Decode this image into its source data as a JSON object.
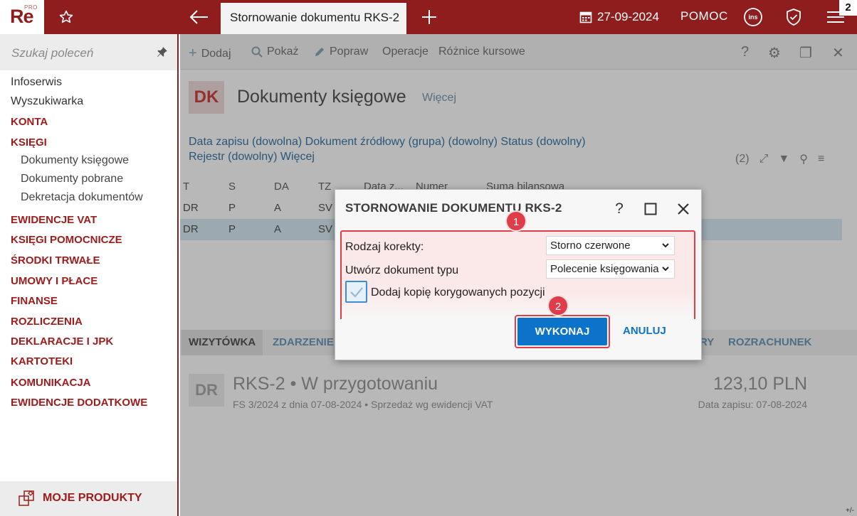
{
  "topbar": {
    "logo_main": "Re",
    "logo_sup": "PRO",
    "tab_title": "Stornowanie dokumentu RKS-2",
    "date": "27-09-2024",
    "help": "POMOC",
    "ins_label": "ins",
    "notification_count": "2"
  },
  "sidebar": {
    "search_placeholder": "Szukaj poleceń",
    "items": [
      {
        "label": "Infoserwis"
      },
      {
        "label": "Wyszukiwarka"
      },
      {
        "label": "KONTA"
      },
      {
        "label": "KSIĘGI"
      },
      {
        "label": "Dokumenty księgowe"
      },
      {
        "label": "Dokumenty pobrane"
      },
      {
        "label": "Dekretacja dokumentów"
      },
      {
        "label": "EWIDENCJE VAT"
      },
      {
        "label": "KSIĘGI POMOCNICZE"
      },
      {
        "label": "ŚRODKI TRWAŁE"
      },
      {
        "label": "UMOWY I PŁACE"
      },
      {
        "label": "FINANSE"
      },
      {
        "label": "ROZLICZENIA"
      },
      {
        "label": "DEKLARACJE I JPK"
      },
      {
        "label": "KARTOTEKI"
      },
      {
        "label": "KOMUNIKACJA"
      },
      {
        "label": "EWIDENCJE DODATKOWE"
      }
    ],
    "footer_label": "MOJE PRODUKTY"
  },
  "main": {
    "toolbar": {
      "add": "Dodaj",
      "show": "Pokaż",
      "edit": "Popraw",
      "operations": "Operacje",
      "fx": "Różnice kursowe",
      "help": "?"
    },
    "page": {
      "badge": "DK",
      "title": "Dokumenty księgowe",
      "more": "Więcej"
    },
    "filters": {
      "line1": "Data zapisu (dowolna)   Dokument źródłowy (grupa) (dowolny)   Status (dowolny)",
      "line2": "Rejestr (dowolny)   Więcej",
      "count": "(2)"
    },
    "grid": {
      "columns": [
        "T",
        "S",
        "DA",
        "TZ",
        "Data z...",
        "Numer",
        "Suma bilansowa"
      ],
      "rows": [
        [
          "DR",
          "P",
          "A",
          "SV"
        ],
        [
          "DR",
          "P",
          "A",
          "SV"
        ]
      ]
    },
    "bottom_tabs": [
      "WIZYTÓWKA",
      "ZDARZENIE",
      "RY",
      "ROZRACHUNEK"
    ],
    "card": {
      "badge": "DR",
      "title": "RKS-2 • W przygotowaniu",
      "subtitle": "FS 3/2024 z dnia 07-08-2024  •  Sprzedaż wg ewidencji VAT",
      "amount": "123,10 PLN",
      "date": "Data zapisu: 07-08-2024"
    },
    "corner": "+/-"
  },
  "dialog": {
    "title": "STORNOWANIE DOKUMENTU RKS-2",
    "help": "?",
    "correction_label": "Rodzaj korekty:",
    "correction_value": "Storno czerwone",
    "doctype_label": "Utwórz dokument typu",
    "doctype_value": "Polecenie księgowania",
    "copy_label": "Dodaj kopię korygowanych pozycji",
    "copy_checked": true,
    "execute": "WYKONAJ",
    "cancel": "ANULUJ",
    "marker1": "1",
    "marker2": "2"
  },
  "colors": {
    "brand": "#8f1d1d",
    "accent_blue": "#0b73c9",
    "highlight_red": "#e03d4a"
  }
}
